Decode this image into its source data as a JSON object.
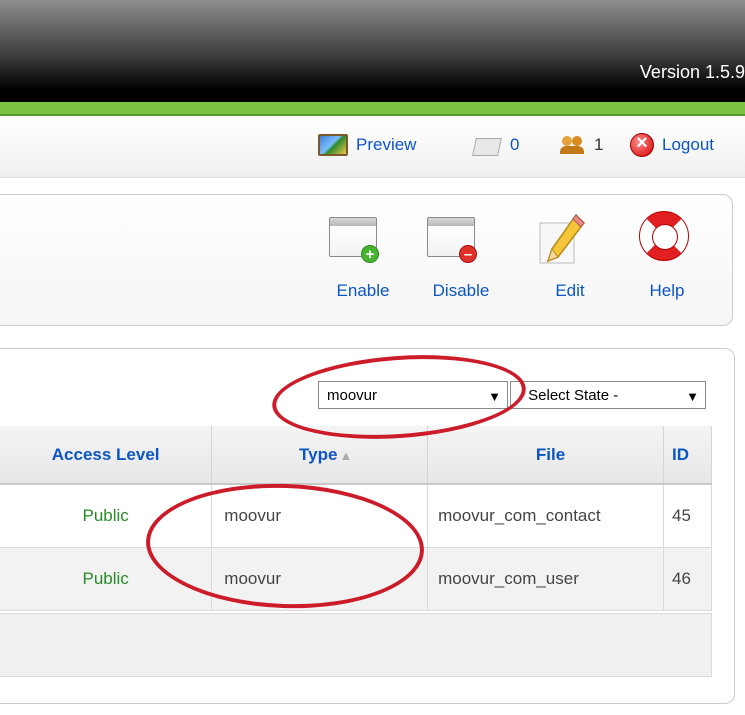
{
  "header": {
    "version": "Version 1.5.9"
  },
  "status_bar": {
    "preview_label": "Preview",
    "messages_count": "0",
    "users_count": "1",
    "logout_label": "Logout"
  },
  "toolbar": {
    "enable_label": "Enable",
    "disable_label": "Disable",
    "edit_label": "Edit",
    "help_label": "Help"
  },
  "filters": {
    "type_selected": "moovur",
    "state_selected": "- Select State -"
  },
  "table": {
    "headers": {
      "access": "Access Level",
      "type": "Type",
      "file": "File",
      "id": "ID"
    },
    "sort_indicator": "▲",
    "rows": [
      {
        "access": "Public",
        "type": "moovur",
        "file": "moovur_com_contact",
        "id": "45"
      },
      {
        "access": "Public",
        "type": "moovur",
        "file": "moovur_com_user",
        "id": "46"
      }
    ]
  },
  "colors": {
    "link": "#0b55c4",
    "public": "#2a8a2a",
    "accent_green": "#7ac142",
    "annotation": "#cc1c2a"
  },
  "icons": {
    "preview": "preview-icon",
    "messages": "messages-icon",
    "users": "users-icon",
    "logout": "logout-icon",
    "enable": "enable-icon",
    "disable": "disable-icon",
    "edit": "pencil-icon",
    "help": "lifebuoy-icon"
  }
}
